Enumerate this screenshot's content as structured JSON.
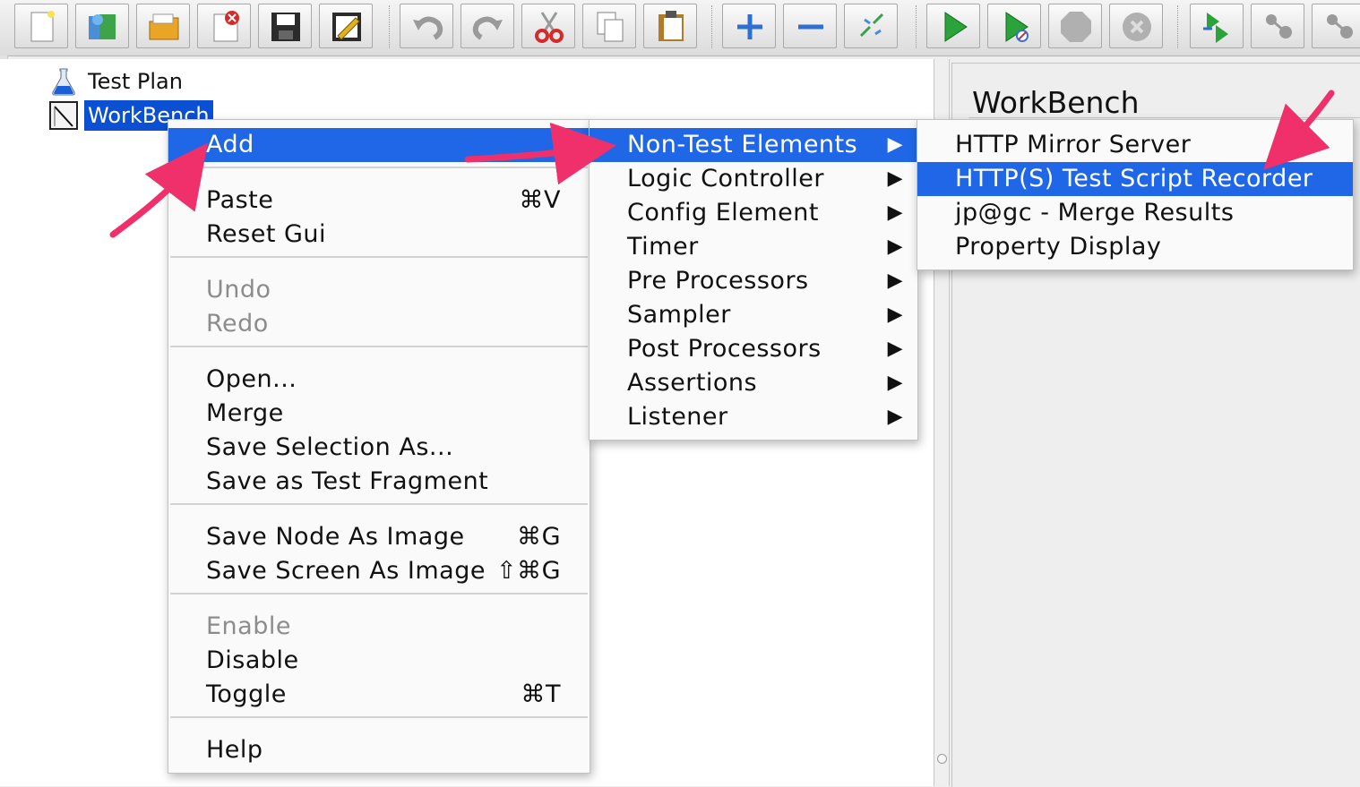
{
  "toolbar": {
    "buttons": [
      {
        "name": "new-icon",
        "color": "#f3f3f3"
      },
      {
        "name": "templates-icon",
        "color": "#3a7fcf"
      },
      {
        "name": "open-icon",
        "color": "#e8a526"
      },
      {
        "name": "close-icon",
        "color": "#d42a2a"
      },
      {
        "name": "save-icon",
        "color": "#2b2b2b"
      },
      {
        "name": "edit-icon",
        "color": "#e0b323"
      },
      {
        "name": "undo-icon",
        "color": "#9a9a9a"
      },
      {
        "name": "redo-icon",
        "color": "#9a9a9a"
      },
      {
        "name": "cut-icon",
        "color": "#d42a2a"
      },
      {
        "name": "copy-icon",
        "color": "#808080"
      },
      {
        "name": "paste-icon",
        "color": "#b07c2a"
      },
      {
        "name": "expand-icon",
        "color": "#2f6fd0"
      },
      {
        "name": "collapse-icon",
        "color": "#2f6fd0"
      },
      {
        "name": "toggle-icon",
        "color": "#3aa14b"
      },
      {
        "name": "start-icon",
        "color": "#2aa33a"
      },
      {
        "name": "start-no-pauses-icon",
        "color": "#2aa33a"
      },
      {
        "name": "stop-icon",
        "color": "#b0b0b0"
      },
      {
        "name": "shutdown-icon",
        "color": "#b0b0b0"
      },
      {
        "name": "remote-start-icon",
        "color": "#2aa33a"
      },
      {
        "name": "remote-stop-icon",
        "color": "#9a9a9a"
      },
      {
        "name": "remote-shutdown-icon",
        "color": "#9a9a9a"
      }
    ]
  },
  "tree": {
    "nodes": [
      {
        "label": "Test Plan",
        "icon": "flask-icon",
        "selected": false
      },
      {
        "label": "WorkBench",
        "icon": "workbench-icon",
        "selected": true
      }
    ]
  },
  "right_panel": {
    "title": "WorkBench"
  },
  "context_menu": {
    "items": [
      {
        "label": "Add",
        "shortcut": "",
        "highlighted": true,
        "disabled": false,
        "submenu": true
      },
      {
        "sep": true
      },
      {
        "label": "Paste",
        "shortcut": "⌘V",
        "disabled": false
      },
      {
        "label": "Reset Gui",
        "shortcut": "",
        "disabled": false
      },
      {
        "sep": true
      },
      {
        "label": "Undo",
        "shortcut": "",
        "disabled": true
      },
      {
        "label": "Redo",
        "shortcut": "",
        "disabled": true
      },
      {
        "sep": true
      },
      {
        "label": "Open...",
        "shortcut": "",
        "disabled": false
      },
      {
        "label": "Merge",
        "shortcut": "",
        "disabled": false
      },
      {
        "label": "Save Selection As...",
        "shortcut": "",
        "disabled": false
      },
      {
        "label": "Save as Test Fragment",
        "shortcut": "",
        "disabled": false
      },
      {
        "sep": true
      },
      {
        "label": "Save Node As Image",
        "shortcut": "⌘G",
        "disabled": false
      },
      {
        "label": "Save Screen As Image",
        "shortcut": "⇧⌘G",
        "disabled": false
      },
      {
        "sep": true
      },
      {
        "label": "Enable",
        "shortcut": "",
        "disabled": true
      },
      {
        "label": "Disable",
        "shortcut": "",
        "disabled": false
      },
      {
        "label": "Toggle",
        "shortcut": "⌘T",
        "disabled": false
      },
      {
        "sep": true
      },
      {
        "label": "Help",
        "shortcut": "",
        "disabled": false
      }
    ]
  },
  "add_submenu": {
    "items": [
      {
        "label": "Non-Test Elements",
        "highlighted": true
      },
      {
        "label": "Logic Controller"
      },
      {
        "label": "Config Element"
      },
      {
        "label": "Timer"
      },
      {
        "label": "Pre Processors"
      },
      {
        "label": "Sampler"
      },
      {
        "label": "Post Processors"
      },
      {
        "label": "Assertions"
      },
      {
        "label": "Listener"
      }
    ],
    "arrow": "▶"
  },
  "non_test_submenu": {
    "items": [
      {
        "label": "HTTP Mirror Server",
        "highlighted": false
      },
      {
        "label": "HTTP(S) Test Script Recorder",
        "highlighted": true
      },
      {
        "label": "jp@gc - Merge Results",
        "highlighted": false
      },
      {
        "label": "Property Display",
        "highlighted": false
      }
    ]
  },
  "colors": {
    "highlight": "#1f67e7",
    "selection": "#0b4fd3",
    "annotation_arrow": "#f0306a"
  }
}
